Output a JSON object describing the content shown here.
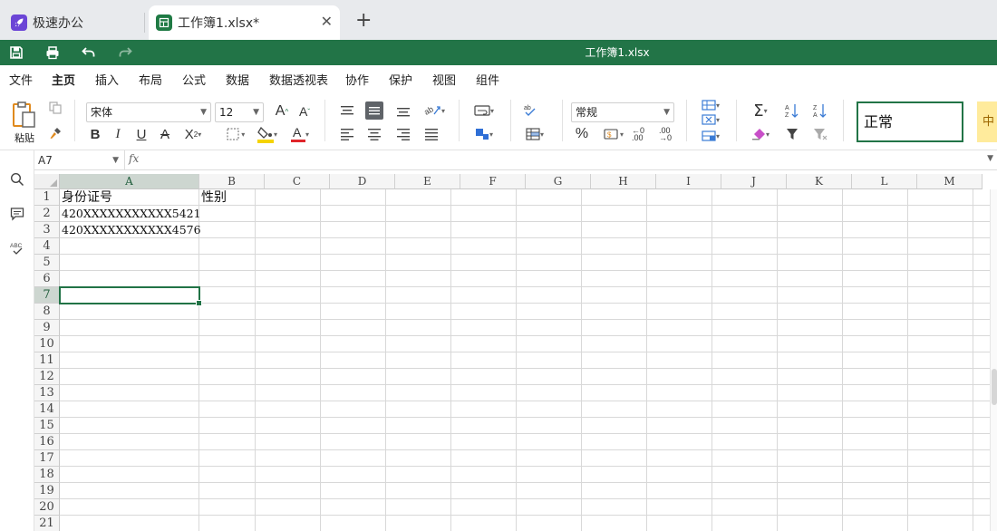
{
  "tabs": [
    {
      "label": "极速办公",
      "icon": "rocket-app-icon"
    },
    {
      "label": "工作簿1.xlsx*",
      "icon": "spreadsheet-app-icon",
      "close": "✕"
    }
  ],
  "tab_add": "+",
  "document_title": "工作簿1.xlsx",
  "menu": [
    "文件",
    "主页",
    "插入",
    "布局",
    "公式",
    "数据",
    "数据透视表",
    "协作",
    "保护",
    "视图",
    "组件"
  ],
  "menu_active": "主页",
  "ribbon": {
    "paste_label": "粘贴",
    "font_name": "宋体",
    "font_size": "12",
    "number_format": "常规",
    "cell_style_normal": "正常",
    "cell_style_mid": "中",
    "colors": {
      "accent": "#227447",
      "font_color_bar": "#e0262b",
      "fill_color_bar": "#f5d300"
    }
  },
  "formula_bar": {
    "name_box": "A7",
    "fx": "fx",
    "formula": ""
  },
  "sheet": {
    "columns": [
      "A",
      "B",
      "C",
      "D",
      "E",
      "F",
      "G",
      "H",
      "I",
      "J",
      "K",
      "L",
      "M"
    ],
    "rows": [
      "1",
      "2",
      "3",
      "4",
      "5",
      "6",
      "7",
      "8",
      "9",
      "10",
      "11",
      "12",
      "13",
      "14",
      "15",
      "16",
      "17",
      "18",
      "19",
      "20",
      "21"
    ],
    "selected_cell": "A7",
    "cells": {
      "A1": "身份证号",
      "B1": "性别",
      "A2": "420XXXXXXXXXXX5421",
      "A3": "420XXXXXXXXXXX4576"
    }
  }
}
